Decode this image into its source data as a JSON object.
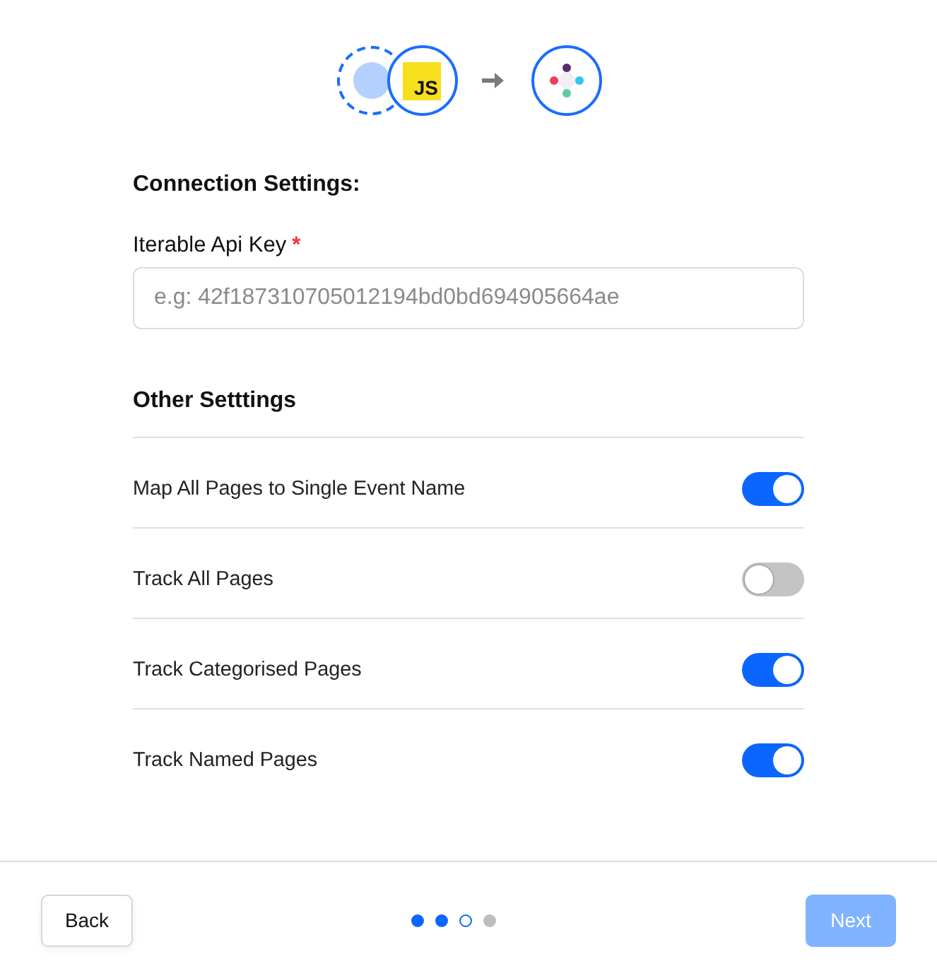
{
  "header": {
    "source_logo": "JS"
  },
  "connection_settings": {
    "title": "Connection Settings:",
    "fields": [
      {
        "label": "Iterable Api Key",
        "required": true,
        "required_mark": "*",
        "placeholder": "e.g: 42f187310705012194bd0bd694905664ae"
      }
    ]
  },
  "other_settings": {
    "title": "Other Setttings",
    "options": [
      {
        "label": "Map All Pages to Single Event Name",
        "on": true
      },
      {
        "label": "Track All Pages",
        "on": false
      },
      {
        "label": "Track Categorised Pages",
        "on": true
      },
      {
        "label": "Track Named Pages",
        "on": true
      }
    ]
  },
  "footer": {
    "back_button": "Back",
    "steps": [
      {
        "completed": true,
        "selected": false
      },
      {
        "completed": true,
        "selected": false
      },
      {
        "completed": false,
        "selected": true
      },
      {
        "completed": false,
        "selected": false
      }
    ],
    "next_button": {
      "label": "Next",
      "disabled": true
    }
  }
}
